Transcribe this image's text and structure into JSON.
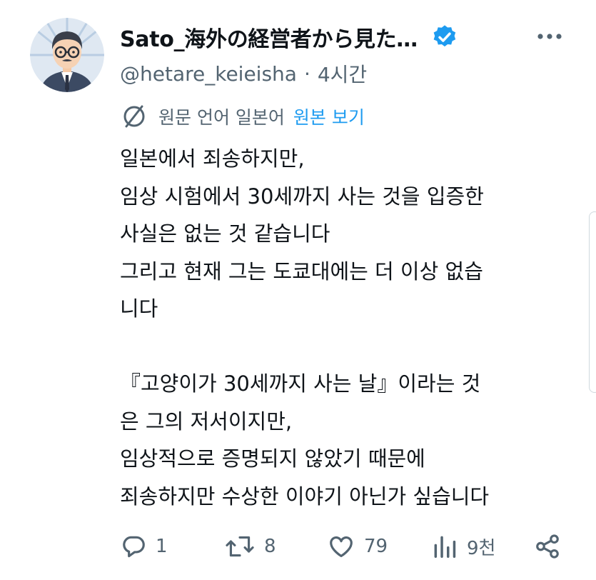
{
  "author": {
    "display_name": "Sato_海外の経営者から見た…",
    "handle": "@hetare_keieisha",
    "separator": "·",
    "time_ago": "4시간",
    "verified": true
  },
  "translation": {
    "notice": "원문 언어 일본어",
    "view_original": "원본 보기",
    "icon": "globe-slash-icon"
  },
  "body": {
    "lines": [
      "일본에서 죄송하지만,",
      "임상 시험에서 30세까지 사는 것을 입증한",
      "사실은 없는 것 같습니다",
      "그리고 현재 그는 도쿄대에는 더 이상 없습",
      "니다",
      "",
      "『고양이가 30세까지 사는 날』이라는 것",
      "은 그의 저서이지만,",
      "임상적으로 증명되지 않았기 때문에",
      "죄송하지만 수상한 이야기 아닌가 싶습니다"
    ]
  },
  "actions": {
    "reply": {
      "icon": "reply-icon",
      "count": "1"
    },
    "repost": {
      "icon": "repost-icon",
      "count": "8"
    },
    "like": {
      "icon": "heart-icon",
      "count": "79"
    },
    "views": {
      "icon": "views-icon",
      "count": "9천"
    },
    "share": {
      "icon": "share-icon"
    }
  },
  "colors": {
    "text": "#0f1419",
    "secondary": "#536471",
    "accent": "#1d9bf0"
  }
}
